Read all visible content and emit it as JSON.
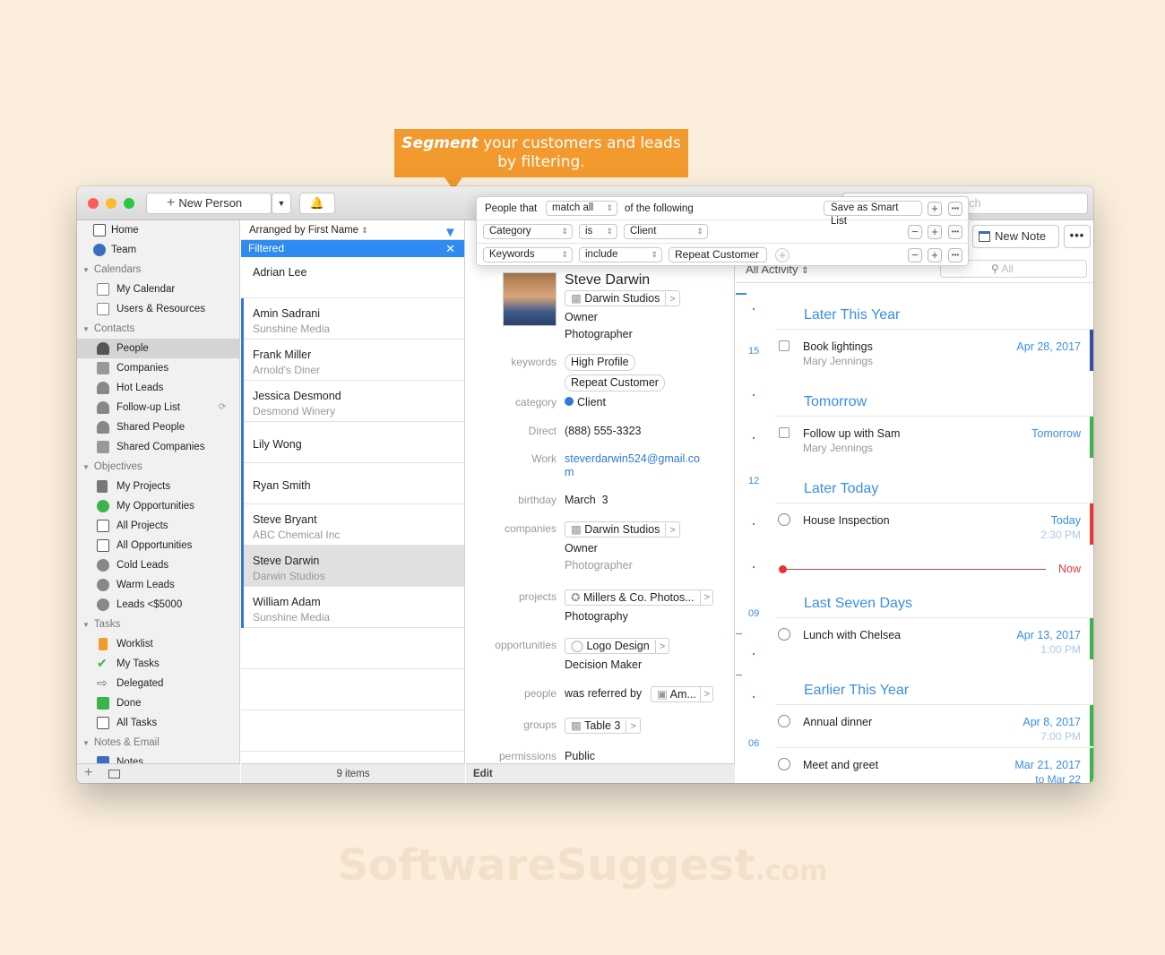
{
  "banner": {
    "emph": "Segment",
    "line1": " your customers and leads",
    "line2": "by filtering."
  },
  "watermark": {
    "main": "SoftwareSuggest",
    "suffix": ".com"
  },
  "toolbar": {
    "new_person": "New Person",
    "search_placeholder": "ch",
    "new_note": "New Note"
  },
  "filter": {
    "prefix": "People that",
    "match": "match all",
    "suffix": "of the following",
    "save": "Save as Smart List",
    "rows": [
      {
        "field": "Category",
        "op": "is",
        "value": "Client"
      },
      {
        "field": "Keywords",
        "op": "include",
        "value": "Repeat Customer"
      }
    ]
  },
  "sidebar": {
    "top": [
      {
        "label": "Home",
        "icon": "home-icon"
      },
      {
        "label": "Team",
        "icon": "team-icon"
      }
    ],
    "calendars": "Calendars",
    "cal_items": [
      {
        "label": "My Calendar"
      },
      {
        "label": "Users & Resources"
      }
    ],
    "contacts": "Contacts",
    "contact_items": [
      {
        "label": "People"
      },
      {
        "label": "Companies"
      },
      {
        "label": "Hot Leads"
      },
      {
        "label": "Follow-up List"
      },
      {
        "label": "Shared People"
      },
      {
        "label": "Shared Companies"
      }
    ],
    "objectives": "Objectives",
    "objective_items": [
      {
        "label": "My Projects"
      },
      {
        "label": "My Opportunities"
      },
      {
        "label": "All Projects"
      },
      {
        "label": "All Opportunities"
      },
      {
        "label": "Cold Leads"
      },
      {
        "label": "Warm Leads"
      },
      {
        "label": "Leads <$5000"
      }
    ],
    "tasks": "Tasks",
    "task_items": [
      {
        "label": "Worklist"
      },
      {
        "label": "My Tasks"
      },
      {
        "label": "Delegated"
      },
      {
        "label": "Done"
      },
      {
        "label": "All Tasks"
      }
    ],
    "notes": "Notes & Email",
    "notes_item": "Notes"
  },
  "list": {
    "arranged": "Arranged by First Name",
    "filtered": "Filtered",
    "count": "9 items",
    "people": [
      {
        "name": "Adrian Lee",
        "company": ""
      },
      {
        "name": "Amin Sadrani",
        "company": "Sunshine Media"
      },
      {
        "name": "Frank Miller",
        "company": "Arnold's Diner"
      },
      {
        "name": "Jessica Desmond",
        "company": "Desmond Winery"
      },
      {
        "name": "Lily Wong",
        "company": ""
      },
      {
        "name": "Ryan Smith",
        "company": ""
      },
      {
        "name": "Steve Bryant",
        "company": "ABC Chemical Inc"
      },
      {
        "name": "Steve Darwin",
        "company": "Darwin Studios"
      },
      {
        "name": "William Adam",
        "company": "Sunshine Media"
      }
    ]
  },
  "detail": {
    "name": "Steve Darwin",
    "company": "Darwin Studios",
    "role": "Owner",
    "title": "Photographer",
    "labels": {
      "keywords": "keywords",
      "category": "category",
      "direct": "Direct",
      "work": "Work",
      "birthday": "birthday",
      "companies": "companies",
      "projects": "projects",
      "opportunities": "opportunities",
      "people": "people",
      "groups": "groups",
      "permissions": "permissions"
    },
    "keywords": [
      "High Profile",
      "Repeat Customer"
    ],
    "category": "Client",
    "direct": "(888) 555-3323",
    "email1": "steverdarwin524@gmail.co",
    "email2": "m",
    "birthday": "March  3",
    "comp_chip": "Darwin Studios",
    "comp_role": "Owner",
    "comp_title": "Photographer",
    "project": "Millers & Co. Photos...",
    "project_role": "Photography",
    "opportunity": "Logo Design",
    "opp_role": "Decision Maker",
    "people_rel": "was referred by",
    "people_chip": "Am...",
    "group": "Table 3",
    "permission": "Public",
    "edit": "Edit"
  },
  "activity": {
    "filter": "All Activity",
    "search": "All",
    "sections": {
      "later_year": "Later This Year",
      "tomorrow": "Tomorrow",
      "later_today": "Later Today",
      "last_seven": "Last Seven Days",
      "earlier_year": "Earlier This Year"
    },
    "days": [
      "15",
      "12",
      "09",
      "06"
    ],
    "events": [
      {
        "title": "Book lightings",
        "sub": "Mary Jennings",
        "date": "Apr 28, 2017",
        "date2": ""
      },
      {
        "title": "Follow up with Sam",
        "sub": "Mary Jennings",
        "date": "Tomorrow",
        "date2": ""
      },
      {
        "title": "House Inspection",
        "sub": "",
        "date": "Today",
        "date2": "2:30 PM"
      },
      {
        "title": "Lunch with Chelsea",
        "sub": "",
        "date": "Apr 13, 2017",
        "date2": "1:00 PM"
      },
      {
        "title": "Annual dinner",
        "sub": "",
        "date": "Apr 8, 2017",
        "date2": "7:00 PM"
      },
      {
        "title": "Meet and greet",
        "sub": "",
        "date": "Mar 21, 2017",
        "date2": "to Mar 22"
      }
    ],
    "now": "Now"
  },
  "colors": {
    "accent": "#2f8bf2",
    "banner": "#f29a2e",
    "now_line": "#e0383b"
  }
}
